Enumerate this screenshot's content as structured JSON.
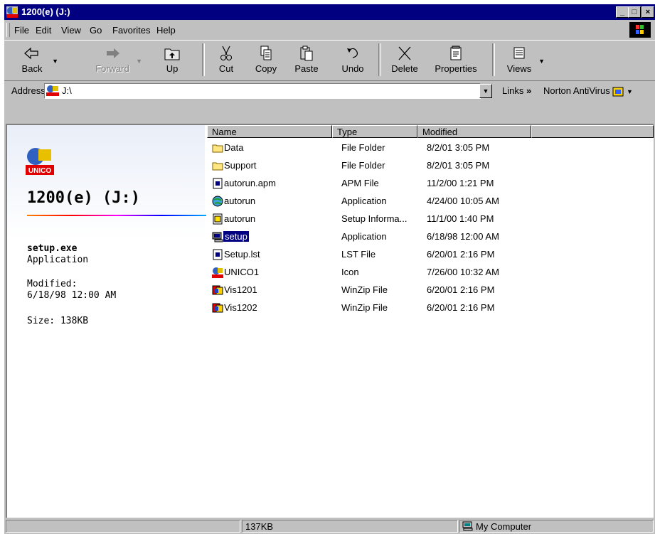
{
  "window": {
    "title": "1200(e) (J:)"
  },
  "menu": [
    "File",
    "Edit",
    "View",
    "Go",
    "Favorites",
    "Help"
  ],
  "toolbar": {
    "buttons": [
      {
        "label": "Back",
        "icon": "back-arrow-icon",
        "enabled": true
      },
      {
        "label": "Forward",
        "icon": "forward-arrow-icon",
        "enabled": false
      },
      {
        "label": "Up",
        "icon": "up-folder-icon",
        "enabled": true
      },
      {
        "label": "Cut",
        "icon": "scissors-icon",
        "enabled": true
      },
      {
        "label": "Copy",
        "icon": "copy-icon",
        "enabled": true
      },
      {
        "label": "Paste",
        "icon": "paste-icon",
        "enabled": true
      },
      {
        "label": "Undo",
        "icon": "undo-icon",
        "enabled": true
      },
      {
        "label": "Delete",
        "icon": "delete-x-icon",
        "enabled": true
      },
      {
        "label": "Properties",
        "icon": "properties-icon",
        "enabled": true
      },
      {
        "label": "Views",
        "icon": "views-icon",
        "enabled": true
      }
    ]
  },
  "address": {
    "label": "Address",
    "value": "J:\\"
  },
  "links": {
    "label": "Links",
    "chevron": "»"
  },
  "norton": {
    "label": "Norton AntiVirus"
  },
  "leftpane": {
    "title": "1200(e) (J:)",
    "selected_name": "setup.exe",
    "selected_type": "Application",
    "modified_label": "Modified:",
    "modified_value": "6/18/98 12:00 AM",
    "size": "Size: 138KB"
  },
  "columns": [
    "Name",
    "Type",
    "Modified"
  ],
  "files": [
    {
      "name": "Data",
      "type": "File Folder",
      "modified": "8/2/01 3:05 PM",
      "icon": "folder-icon"
    },
    {
      "name": "Support",
      "type": "File Folder",
      "modified": "8/2/01 3:05 PM",
      "icon": "folder-icon"
    },
    {
      "name": "autorun.apm",
      "type": "APM File",
      "modified": "11/2/00 1:21 PM",
      "icon": "file-icon"
    },
    {
      "name": "autorun",
      "type": "Application",
      "modified": "4/24/00 10:05 AM",
      "icon": "app-globe-icon"
    },
    {
      "name": "autorun",
      "type": "Setup Informa...",
      "modified": "11/1/00 1:40 PM",
      "icon": "setup-info-icon"
    },
    {
      "name": "setup",
      "type": "Application",
      "modified": "6/18/98 12:00 AM",
      "icon": "setup-computer-icon",
      "selected": true
    },
    {
      "name": "Setup.lst",
      "type": "LST File",
      "modified": "6/20/01 2:16 PM",
      "icon": "file-icon"
    },
    {
      "name": "UNICO1",
      "type": "Icon",
      "modified": "7/26/00 10:32 AM",
      "icon": "unico-icon"
    },
    {
      "name": "Vis1201",
      "type": "WinZip File",
      "modified": "6/20/01 2:16 PM",
      "icon": "winzip-icon"
    },
    {
      "name": "Vis1202",
      "type": "WinZip File",
      "modified": "6/20/01 2:16 PM",
      "icon": "winzip-icon"
    }
  ],
  "status": {
    "size": "137KB",
    "zone": "My Computer"
  },
  "colors": {
    "titlebar": "#000080",
    "selection": "#000080",
    "chrome": "#c0c0c0"
  }
}
